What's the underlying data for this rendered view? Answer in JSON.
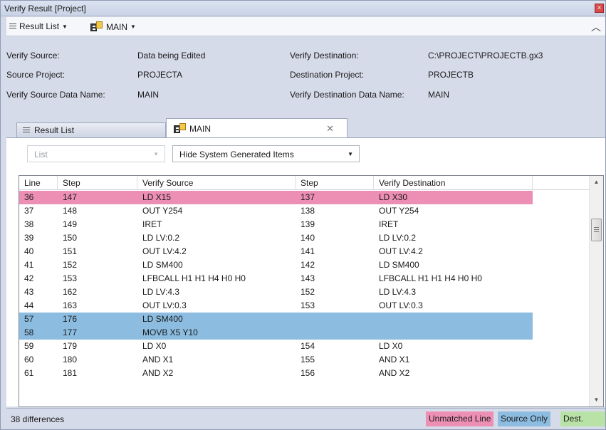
{
  "window": {
    "title": "Verify Result [Project]"
  },
  "toolbar": {
    "result_list_label": "Result List",
    "program_label": "MAIN"
  },
  "info": {
    "verify_source_label": "Verify Source:",
    "verify_source_value": "Data being Edited",
    "source_project_label": "Source Project:",
    "source_project_value": "PROJECTA",
    "verify_source_data_name_label": "Verify Source Data Name:",
    "verify_source_data_name_value": "MAIN",
    "verify_destination_label": "Verify Destination:",
    "verify_destination_value": "C:\\PROJECT\\PROJECTB.gx3",
    "destination_project_label": "Destination Project:",
    "destination_project_value": "PROJECTB",
    "verify_destination_data_name_label": "Verify Destination Data Name:",
    "verify_destination_data_name_value": "MAIN"
  },
  "tabs": [
    {
      "label": "Result List",
      "icon": "list-icon",
      "active": false
    },
    {
      "label": "MAIN",
      "icon": "program-icon",
      "active": true
    }
  ],
  "filters": {
    "list_value": "List",
    "system_items_value": "Hide System Generated Items"
  },
  "grid": {
    "columns": [
      "Line",
      "Step",
      "Verify Source",
      "Step",
      "Verify Destination"
    ],
    "rows": [
      {
        "line": "36",
        "step": "147",
        "src": "LD X15",
        "dstep": "137",
        "dst": "LD X30",
        "type": "unmatched"
      },
      {
        "line": "37",
        "step": "148",
        "src": "OUT Y254",
        "dstep": "138",
        "dst": "OUT Y254",
        "type": "normal"
      },
      {
        "line": "38",
        "step": "149",
        "src": "IRET",
        "dstep": "139",
        "dst": "IRET",
        "type": "normal"
      },
      {
        "line": "39",
        "step": "150",
        "src": "LD LV:0.2",
        "dstep": "140",
        "dst": "LD LV:0.2",
        "type": "normal"
      },
      {
        "line": "40",
        "step": "151",
        "src": "OUT LV:4.2",
        "dstep": "141",
        "dst": "OUT LV:4.2",
        "type": "normal"
      },
      {
        "line": "41",
        "step": "152",
        "src": "LD SM400",
        "dstep": "142",
        "dst": "LD SM400",
        "type": "normal"
      },
      {
        "line": "42",
        "step": "153",
        "src": "LFBCALL H1 H1 H4 H0 H0",
        "dstep": "143",
        "dst": "LFBCALL H1 H1 H4 H0 H0",
        "type": "normal"
      },
      {
        "line": "43",
        "step": "162",
        "src": "LD LV:4.3",
        "dstep": "152",
        "dst": "LD LV:4.3",
        "type": "normal"
      },
      {
        "line": "44",
        "step": "163",
        "src": "OUT LV:0.3",
        "dstep": "153",
        "dst": "OUT LV:0.3",
        "type": "normal"
      },
      {
        "line": "57",
        "step": "176",
        "src": "LD SM400",
        "dstep": "",
        "dst": "",
        "type": "srconly"
      },
      {
        "line": "58",
        "step": "177",
        "src": "MOVB X5 Y10",
        "dstep": "",
        "dst": "",
        "type": "srconly"
      },
      {
        "line": "59",
        "step": "179",
        "src": "LD X0",
        "dstep": "154",
        "dst": "LD X0",
        "type": "normal"
      },
      {
        "line": "60",
        "step": "180",
        "src": "AND X1",
        "dstep": "155",
        "dst": "AND X1",
        "type": "normal"
      },
      {
        "line": "61",
        "step": "181",
        "src": "AND X2",
        "dstep": "156",
        "dst": "AND X2",
        "type": "normal"
      }
    ]
  },
  "status": {
    "count": "38 differences",
    "legend_unmatched": "Unmatched Line",
    "legend_source_only": "Source Only",
    "legend_dest_only": "Dest. Only"
  },
  "colors": {
    "unmatched": "#ed8fb4",
    "source_only": "#8cbde1",
    "dest_only": "#b9e3a6"
  }
}
